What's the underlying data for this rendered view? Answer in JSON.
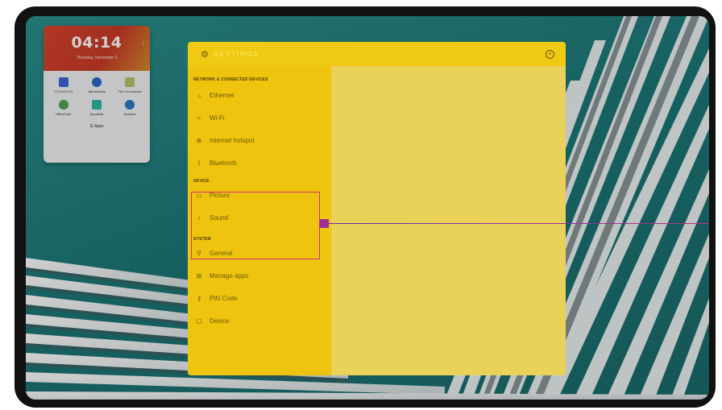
{
  "widget": {
    "time": "04:14",
    "date": "Thursday, November 2",
    "apps": [
      {
        "label": "CTOUCH Fix",
        "color": "#3b63d6"
      },
      {
        "label": "UBoardMate",
        "color": "#2d66c9"
      },
      {
        "label": "File Commander",
        "color": "#b9c36a"
      },
      {
        "label": "OfficeSuite",
        "color": "#4fa34f"
      },
      {
        "label": "AquaMail",
        "color": "#2fb7a2"
      },
      {
        "label": "Browser",
        "color": "#2d74c4"
      }
    ],
    "apps_button": "Apps"
  },
  "settings": {
    "title": "SETTINGS",
    "sections": [
      {
        "title": "NETWORK & CONNECTED DEVICES",
        "items": [
          {
            "label": "Ethernet",
            "icon": "⌂",
            "icon_name": "ethernet-icon"
          },
          {
            "label": "Wi-Fi",
            "icon": "≈",
            "icon_name": "wifi-icon"
          },
          {
            "label": "Internet hotspot",
            "icon": "⊕",
            "icon_name": "hotspot-icon"
          },
          {
            "label": "Bluetooth",
            "icon": "ᛒ",
            "icon_name": "bluetooth-icon"
          }
        ]
      },
      {
        "title": "DEVICE",
        "items": [
          {
            "label": "Picture",
            "icon": "▭",
            "icon_name": "picture-icon"
          },
          {
            "label": "Sound",
            "icon": "♪",
            "icon_name": "sound-icon"
          }
        ]
      },
      {
        "title": "SYSTEM",
        "items": [
          {
            "label": "General",
            "icon": "⚲",
            "icon_name": "general-icon"
          },
          {
            "label": "Manage apps",
            "icon": "⊞",
            "icon_name": "manage-apps-icon"
          },
          {
            "label": "PIN Code",
            "icon": "⚷",
            "icon_name": "pin-code-icon"
          },
          {
            "label": "Device",
            "icon": "▢",
            "icon_name": "device-icon"
          }
        ]
      }
    ]
  },
  "colors": {
    "highlight": "#d2336f",
    "dialog_yellow": "#f1cd1a",
    "content_yellow": "#e9d15a"
  }
}
